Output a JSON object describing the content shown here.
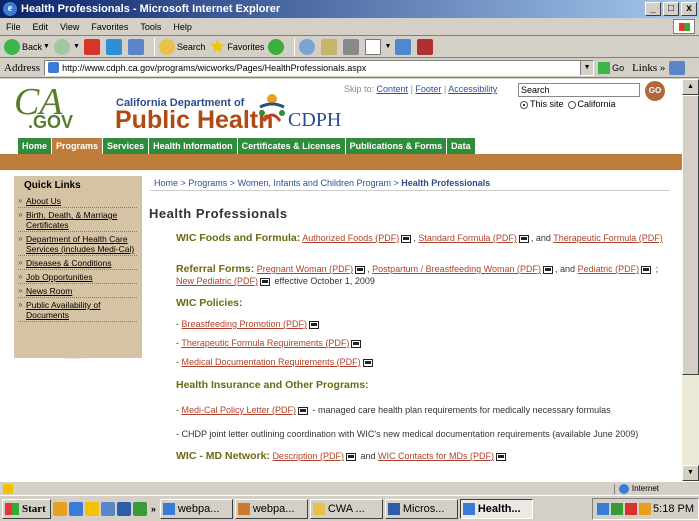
{
  "window": {
    "title": "Health Professionals - Microsoft Internet Explorer",
    "buttons": {
      "minimize": "_",
      "maximize": " ",
      "close": "x"
    }
  },
  "menu": [
    "File",
    "Edit",
    "View",
    "Favorites",
    "Tools",
    "Help"
  ],
  "toolbar": {
    "back": "Back",
    "search": "Search",
    "favorites": "Favorites"
  },
  "address": {
    "label": "Address",
    "url": "http://www.cdph.ca.gov/programs/wicworks/Pages/HealthProfessionals.aspx",
    "go": "Go",
    "links": "Links"
  },
  "header": {
    "logo_ca": "CA",
    "logo_gov": ".GOV",
    "dept_sub": "California Department of",
    "dept_main": "Public Health",
    "dept_abbr": "CDPH",
    "skip_prefix": "Skip to:",
    "skip_links": [
      "Content",
      "Footer",
      "Accessibility"
    ],
    "search_value": "Search",
    "go_label": "GO",
    "radio_this_site": "This site",
    "radio_california": "California"
  },
  "nav": [
    "Home",
    "Programs",
    "Services",
    "Health Information",
    "Certificates & Licenses",
    "Publications & Forms",
    "Data"
  ],
  "sidebar": {
    "title": "Quick Links",
    "items": [
      "About Us",
      "Birth, Death, & Marriage Certificates",
      "Department of Health Care Services (includes Medi-Cal)",
      "Diseases & Conditions",
      "Job Opportunities",
      "News Room",
      "Public Availability of Documents"
    ]
  },
  "breadcrumb": {
    "items": [
      "Home",
      "Programs",
      "Women, Infants and Children Program"
    ],
    "sep": " > ",
    "current": "Health Professionals"
  },
  "page": {
    "title": "Health Professionals",
    "wic_foods": {
      "heading": "WIC Foods and Formula:",
      "link1": "Authorized Foods (PDF)",
      "link2": "Standard Formula (PDF)",
      "and": ", and",
      "link3": "Therapeutic Formula (PDF)"
    },
    "referral": {
      "heading": "Referral Forms:",
      "link1": "Pregnant Woman (PDF)",
      "link2": "Postpartum / Breastfeeding Woman (PDF)",
      "and": ", and",
      "link3": "Pediatric (PDF)",
      "link4": "New Pediatric (PDF)",
      "effective": "effective October 1, 2009"
    },
    "policies": {
      "heading": "WIC Policies:",
      "items": [
        "Breastfeeding Promotion (PDF)",
        "Therapeutic Formula Requirements (PDF)",
        "Medical Documentation Requirements (PDF)"
      ]
    },
    "insurance": {
      "heading": "Health Insurance and Other Programs:",
      "medical_link": "Medi-Cal Policy Letter (PDF)",
      "medical_desc": "- managed care health plan requirements for medically necessary formulas",
      "chdp": "- CHDP joint letter outlining coordination with WIC's new medical documentation requirements (available June 2009)"
    },
    "md_network": {
      "heading": "WIC - MD Network:",
      "link1": "Description (PDF)",
      "and": "and",
      "link2": "WIC Contacts for MDs (PDF)"
    }
  },
  "status": {
    "zone": "Internet"
  },
  "taskbar": {
    "start": "Start",
    "tasks": [
      "webpa...",
      "webpa...",
      "CWA ...",
      "Micros...",
      "Health..."
    ],
    "time": "5:18 PM"
  }
}
